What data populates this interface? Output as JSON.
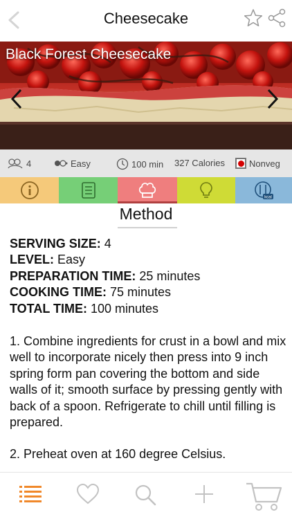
{
  "navbar": {
    "back_icon": "chevron-left-icon",
    "title": "Cheesecake",
    "star_icon": "star-icon",
    "share_icon": "share-icon"
  },
  "hero": {
    "recipe_name": "Black Forest Cheesecake",
    "prev_icon": "chevron-left-icon",
    "next_icon": "chevron-right-icon"
  },
  "info": {
    "servings": "4",
    "level": "Easy",
    "time": "100 min",
    "calories": "327 Calories",
    "diet": "Nonveg",
    "diet_color": "#d40000"
  },
  "tabs": [
    {
      "name": "info",
      "icon": "info-icon",
      "color": "#f5c97a"
    },
    {
      "name": "ingredients",
      "icon": "list-icon",
      "color": "#76cf77"
    },
    {
      "name": "method",
      "icon": "chef-hat-icon",
      "color": "#ef7e7e"
    },
    {
      "name": "tips",
      "icon": "lightbulb-icon",
      "color": "#cfdb36"
    },
    {
      "name": "nutrition",
      "icon": "kcal-icon",
      "color": "#8ab8da"
    }
  ],
  "method": {
    "heading": "Method",
    "details": [
      {
        "label": "SERVING SIZE:",
        "value": " 4"
      },
      {
        "label": "LEVEL:",
        "value": " Easy"
      },
      {
        "label": "PREPARATION TIME:",
        "value": " 25 minutes"
      },
      {
        "label": "COOKING TIME:",
        "value": " 75 minutes"
      },
      {
        "label": "TOTAL TIME:",
        "value": " 100 minutes"
      }
    ],
    "steps": [
      "1. Combine ingredients for crust in a bowl and mix well to incorporate nicely then press into 9 inch spring form pan covering the bottom and side walls of it;  smooth surface by pressing gently with back of a spoon. Refrigerate to chill until filling is prepared.",
      "2. Preheat oven at 160 degree Celsius."
    ]
  },
  "tabbar": {
    "accent": "#f0882a",
    "inactive": "#c7c7c7",
    "items": [
      "list-icon",
      "heart-icon",
      "search-icon",
      "plus-icon",
      "cart-icon"
    ]
  }
}
